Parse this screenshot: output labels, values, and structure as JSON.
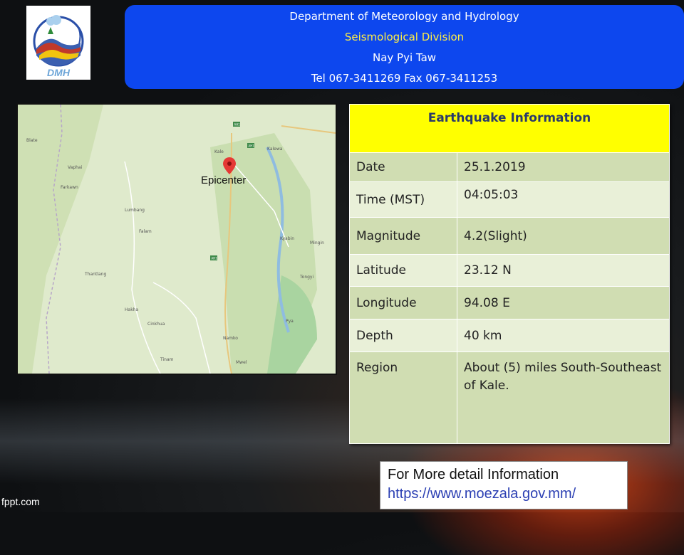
{
  "header": {
    "line1": "Department of Meteorology and Hydrology",
    "line2": "Seismological Division",
    "line3": "Nay Pyi Taw",
    "line4": "Tel 067-3411269 Fax 067-3411253"
  },
  "logo": {
    "text": "DMH"
  },
  "map": {
    "epicenter_label": "Epicenter",
    "places": [
      "Blate",
      "Vaphai",
      "Farkawn",
      "Lumbang",
      "Falam",
      "Thantlang",
      "Hakha",
      "Cinkhua",
      "Tinam",
      "Kale",
      "Kalewa",
      "Namko",
      "Mwel",
      "Kyabin",
      "Mingin",
      "Tongyi",
      "Pya"
    ],
    "road_labels": [
      "AH1",
      "AH1",
      "AH1"
    ]
  },
  "info": {
    "title": "Earthquake Information",
    "rows": [
      {
        "label": "Date",
        "value": "25.1.2019"
      },
      {
        "label": "Time (MST)",
        "value": "04:05:03"
      },
      {
        "label": "Magnitude",
        "value": "4.2(Slight)"
      },
      {
        "label": "Latitude",
        "value": "23.12 N"
      },
      {
        "label": "Longitude",
        "value": "94.08 E"
      },
      {
        "label": "Depth",
        "value": "40 km"
      },
      {
        "label": "Region",
        "value": "About (5) miles South-Southeast of Kale."
      }
    ]
  },
  "more_info": {
    "line1": "For More detail Information",
    "link": "https://www.moezala.gov.mm/"
  },
  "footer": {
    "text": "fppt.com"
  },
  "colors": {
    "header_bg": "#0d47ee",
    "title_bg": "#ffff00",
    "row_dark": "#d0ddb2",
    "row_light": "#e9f0d8"
  }
}
